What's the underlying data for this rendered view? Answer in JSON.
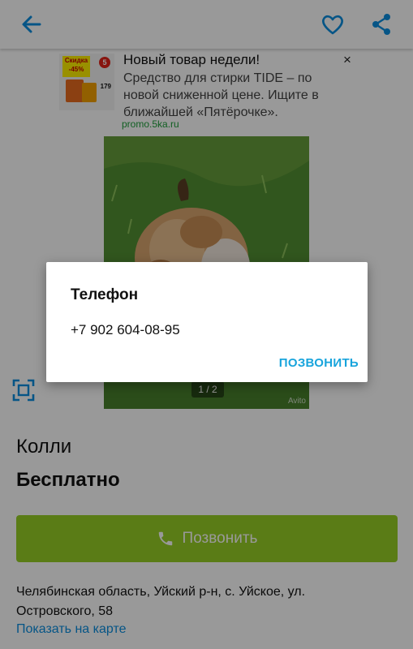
{
  "toolbar": {
    "back_icon": "arrow-left-icon",
    "favorite_icon": "heart-outline-icon",
    "share_icon": "share-icon",
    "accent": "#0a8ee0"
  },
  "ad": {
    "thumb_badge": "Скидка -45%",
    "thumb_price": "179",
    "title": "Новый товар недели!",
    "body": "Средство для стирки TIDE – по новой сниженной цене. Ищите в ближайшей «Пятёрочке».",
    "domain": "promo.5ka.ru",
    "close_label": "×"
  },
  "photo": {
    "counter": "1 / 2",
    "watermark": "Avito"
  },
  "listing": {
    "title": "Колли",
    "price": "Бесплатно",
    "call_button_label": "Позвонить",
    "call_button_color": "#97cf26",
    "address": "Челябинская область, Уйский р-н, с. Уйское, ул. Островского, 58",
    "map_link": "Показать на карте"
  },
  "dialog": {
    "title": "Телефон",
    "phone": "+7 902 604-08-95",
    "action": "ПОЗВОНИТЬ",
    "action_color": "#18a4dc"
  }
}
